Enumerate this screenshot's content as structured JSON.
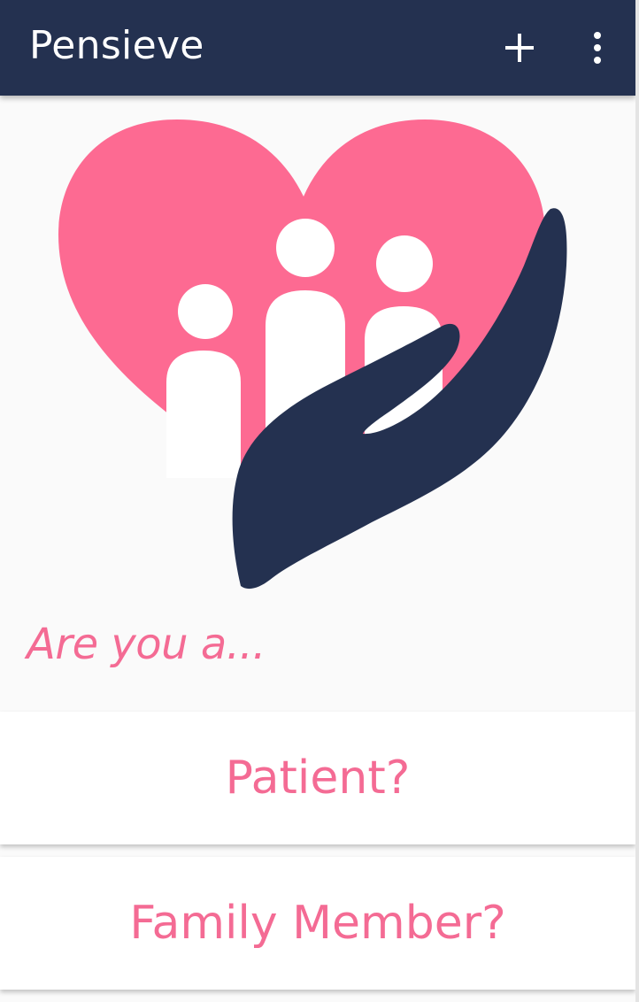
{
  "app_bar": {
    "title": "Pensieve",
    "add_icon": "plus-icon",
    "menu_icon": "more-vert-icon"
  },
  "logo": {
    "icon": "heart-family-hand-logo",
    "colors": {
      "heart": "#fd6a92",
      "hand": "#243150",
      "people": "#ffffff"
    }
  },
  "prompt": "Are you a...",
  "choices": [
    {
      "label": "Patient?"
    },
    {
      "label": "Family Member?"
    }
  ],
  "colors": {
    "primary": "#243150",
    "accent": "#f46b94",
    "background": "#fafafa",
    "card": "#ffffff"
  }
}
